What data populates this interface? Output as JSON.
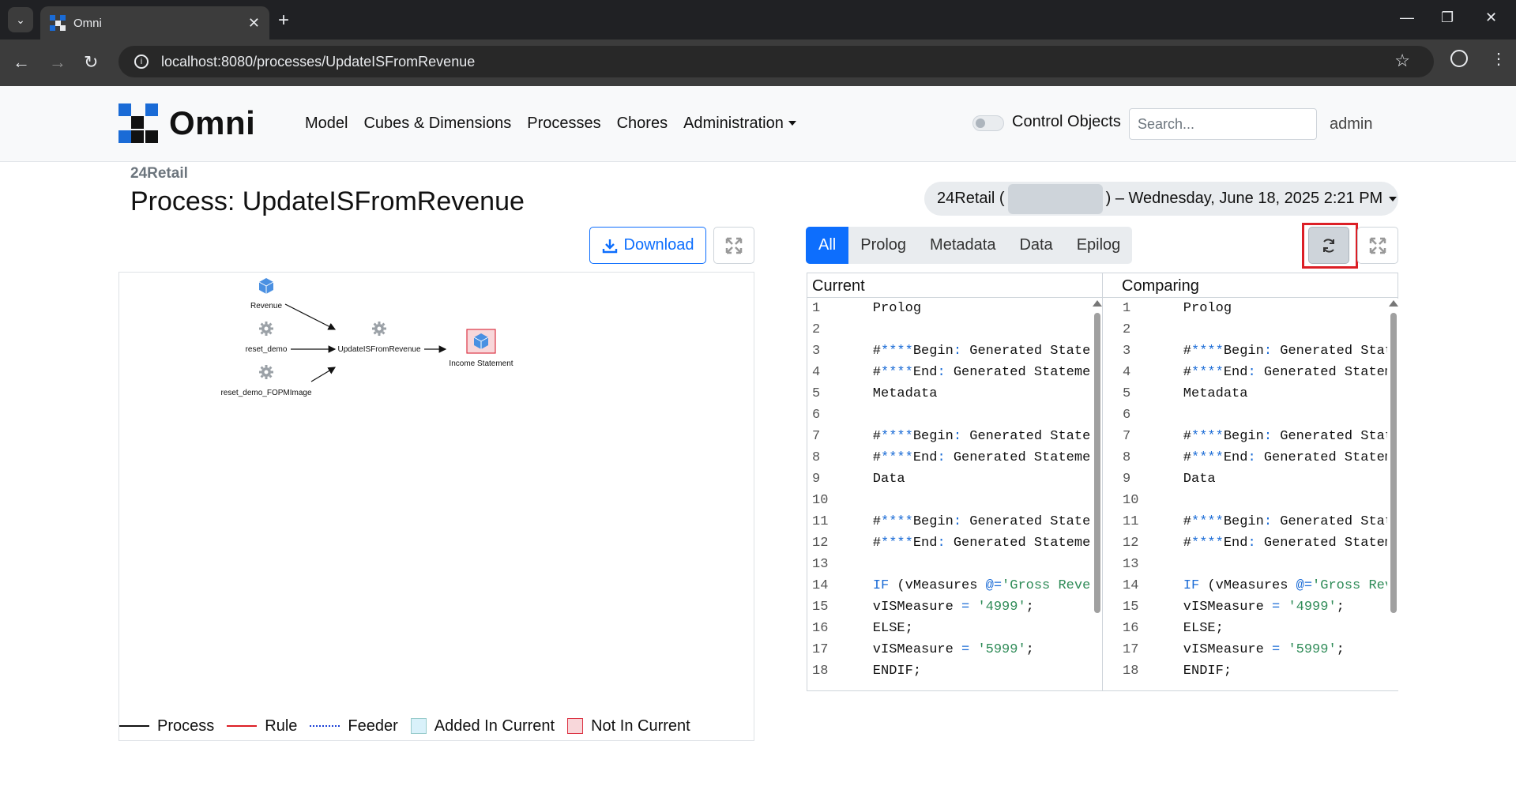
{
  "browser": {
    "tab_title": "Omni",
    "url": "localhost:8080/processes/UpdateISFromRevenue"
  },
  "header": {
    "logo_text": "Omni",
    "nav": [
      "Model",
      "Cubes & Dimensions",
      "Processes",
      "Chores",
      "Administration"
    ],
    "control_objects_label": "Control Objects",
    "search_placeholder": "Search...",
    "user": "admin"
  },
  "page": {
    "breadcrumb": "24Retail",
    "title": "Process: UpdateISFromRevenue",
    "download_label": "Download"
  },
  "diagram": {
    "nodes": [
      {
        "label": "Revenue",
        "kind": "cube"
      },
      {
        "label": "reset_demo",
        "kind": "process"
      },
      {
        "label": "reset_demo_FOPMImage",
        "kind": "process"
      },
      {
        "label": "UpdateISFromRevenue",
        "kind": "process"
      },
      {
        "label": "Income Statement",
        "kind": "cube-not-in-current"
      }
    ],
    "legend": [
      "Process",
      "Rule",
      "Feeder",
      "Added In Current",
      "Not In Current"
    ]
  },
  "version": {
    "prefix": "24Retail (",
    "suffix": ") – Wednesday, June 18, 2025 2:21 PM"
  },
  "tabs": [
    "All",
    "Prolog",
    "Metadata",
    "Data",
    "Epilog"
  ],
  "diff": {
    "current_header": "Current",
    "comparing_header": "Comparing",
    "line_numbers": [
      "1",
      "2",
      "3",
      "4",
      "5",
      "6",
      "7",
      "8",
      "9",
      "10",
      "11",
      "12",
      "13",
      "14",
      "15",
      "16",
      "17",
      "18"
    ]
  },
  "colors": {
    "primary": "#0d6efd",
    "highlight": "#dc1f26",
    "added": "#d9f1fa",
    "not_in_current": "#f8d7da"
  }
}
